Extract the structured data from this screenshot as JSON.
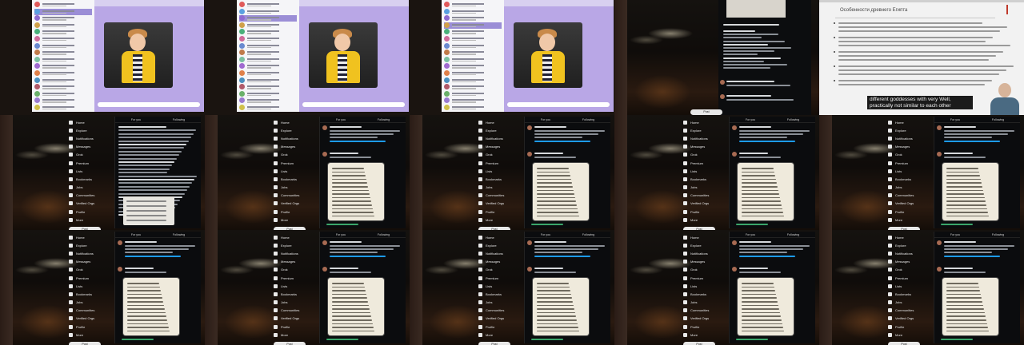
{
  "nav": {
    "items": [
      "Home",
      "Explore",
      "Notifications",
      "Messages",
      "Grok",
      "Premium",
      "Lists",
      "Bookmarks",
      "Jobs",
      "Communities",
      "Verified Orgs",
      "Profile",
      "More"
    ],
    "post_label": "Post"
  },
  "tabs": [
    "For you",
    "Following"
  ],
  "slide": {
    "title": "Особенности древнего Египта",
    "subtitle": "different goddesses with very Well, practically not similar to each other"
  },
  "colors": {
    "x_bg": "#0b0c0e",
    "link": "#1d9bf0",
    "messenger_purple": "#b9a7e6",
    "highlight": "#9b8ed6"
  },
  "tiles": [
    {
      "type": "messenger",
      "selected_row": 1
    },
    {
      "type": "messenger",
      "selected_row": 2
    },
    {
      "type": "messenger",
      "selected_row": 3
    },
    {
      "type": "x-top"
    },
    {
      "type": "slide"
    },
    {
      "type": "x-feed",
      "variant": "list"
    },
    {
      "type": "x-feed",
      "variant": "card"
    },
    {
      "type": "x-feed",
      "variant": "card"
    },
    {
      "type": "x-feed",
      "variant": "card"
    },
    {
      "type": "x-feed",
      "variant": "card"
    },
    {
      "type": "x-feed",
      "variant": "card"
    },
    {
      "type": "x-feed",
      "variant": "card"
    },
    {
      "type": "x-feed",
      "variant": "card"
    },
    {
      "type": "x-feed",
      "variant": "card"
    },
    {
      "type": "x-feed",
      "variant": "card"
    }
  ]
}
